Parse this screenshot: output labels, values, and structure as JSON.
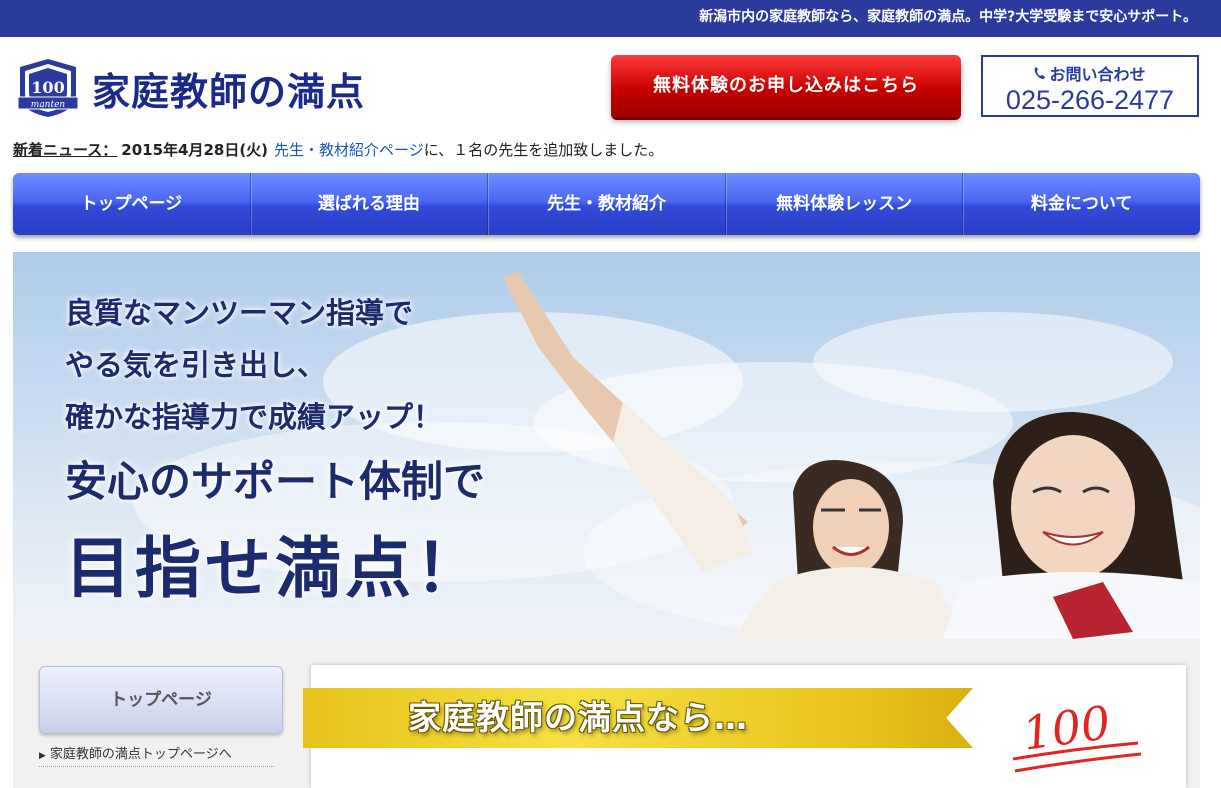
{
  "topbar": {
    "tagline": "新潟市内の家庭教師なら、家庭教師の満点。中学?大学受験まで安心サポート。"
  },
  "header": {
    "logo_text": "家庭教師の満点",
    "logo_badge_number": "100",
    "logo_badge_word": "manten",
    "trial_button_label": "無料体験のお申し込みはこちら",
    "contact_label": "お問い合わせ",
    "contact_phone": "025-266-2477"
  },
  "news": {
    "label": "新着ニュース：",
    "date": "2015年4月28日(火)",
    "link_text": "先生・教材紹介ページ",
    "message": "に、１名の先生を追加致しました。"
  },
  "nav": {
    "items": [
      {
        "label": "トップページ"
      },
      {
        "label": "選ばれる理由"
      },
      {
        "label": "先生・教材紹介"
      },
      {
        "label": "無料体験レッスン"
      },
      {
        "label": "料金について"
      }
    ]
  },
  "hero": {
    "lines": [
      "良質なマンツーマン指導で",
      "やる気を引き出し、",
      "確かな指導力で成績アップ！"
    ],
    "big_line_1": "安心のサポート体制で",
    "big_line_2": "目指せ満点！"
  },
  "sidebar": {
    "button_label": "トップページ",
    "link_text": "家庭教師の満点トップページへ"
  },
  "main": {
    "banner_text": "家庭教師の満点なら…",
    "score_text": "100"
  },
  "colors": {
    "topbar": "#2b3a9d",
    "brand_navy": "#1b2a8a",
    "trial_red": "#c80000",
    "nav_blue": "#3a55e0",
    "banner_gold": "#e6c31a",
    "score_red": "#e0261f"
  }
}
